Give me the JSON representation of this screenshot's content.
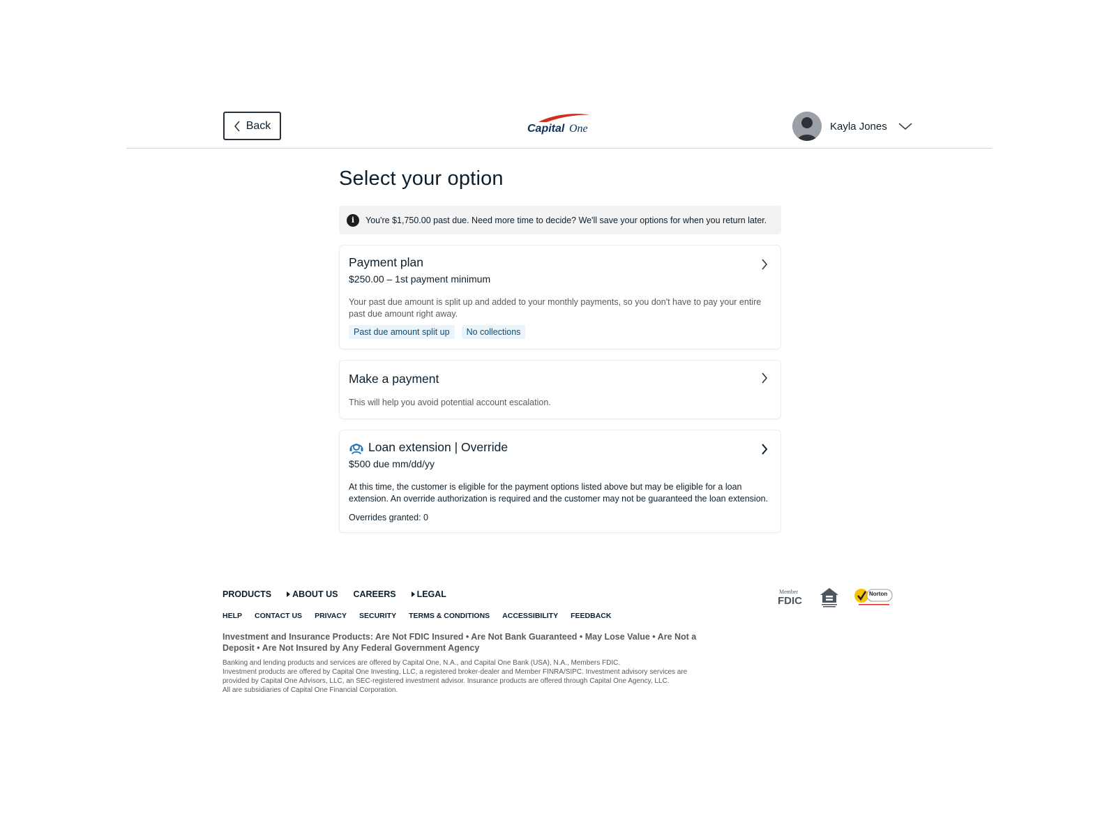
{
  "header": {
    "back_label": "Back",
    "logo_text_capital": "Capital",
    "logo_text_one": "One",
    "user_name": "Kayla Jones"
  },
  "main": {
    "title": "Select your option",
    "banner": "You're $1,750.00 past due. Need more time to decide? We'll save your options for when you return later.",
    "cards": [
      {
        "title": "Payment plan",
        "subtitle": "$250.00 – 1st payment minimum",
        "description": "Your past due amount is split up and added to your monthly payments, so you don't have to pay your entire past due amount right away.",
        "tags": [
          "Past due amount split up",
          "No collections"
        ]
      },
      {
        "title": "Make a payment",
        "description": "This will help you avoid potential account escalation."
      },
      {
        "title": "Loan extension | Override",
        "subtitle": "$500 due mm/dd/yy",
        "description": "At this time, the customer is eligible for the payment options listed above but may be eligible for a loan extension. An override authorization is required and the customer may not be guaranteed the loan extension.",
        "overrides": "Overrides granted: 0"
      }
    ]
  },
  "footer": {
    "primary_links": [
      "PRODUCTS",
      "ABOUT US",
      "CAREERS",
      "LEGAL"
    ],
    "secondary_links": [
      "HELP",
      "CONTACT US",
      "PRIVACY",
      "SECURITY",
      "TERMS & CONDITIONS",
      "ACCESSIBILITY",
      "FEEDBACK"
    ],
    "disclaimer_bold": "Investment and Insurance Products: Are Not FDIC Insured • Are Not Bank Guaranteed • May Lose Value • Are Not a Deposit • Are Not Insured by Any Federal Government Agency",
    "disclaimer_lines": [
      "Banking and lending products and services are offered by Capital One, N.A., and Capital One Bank (USA), N.A., Members FDIC.",
      "Investment products are offered by Capital One Investing, LLC, a registered broker-dealer and Member FINRA/SIPC. Investment advisory services are provided by Capital One Advisors, LLC, an SEC-registered investment advisor. Insurance products are offered through Capital One Agency, LLC.",
      "All are subsidiaries of Capital One Financial Corporation."
    ],
    "badges": {
      "fdic_member": "Member",
      "fdic": "FDIC",
      "norton": "Norton"
    }
  },
  "colors": {
    "brand_navy": "#0d2f5a",
    "brand_red": "#d22e1e",
    "tag_bg": "#eaf4fa",
    "tag_text": "#0f4d75"
  },
  "icons": [
    "chevron-left-icon",
    "chevron-down-icon",
    "chevron-right-icon",
    "info-icon",
    "headset-icon",
    "avatar-icon"
  ]
}
